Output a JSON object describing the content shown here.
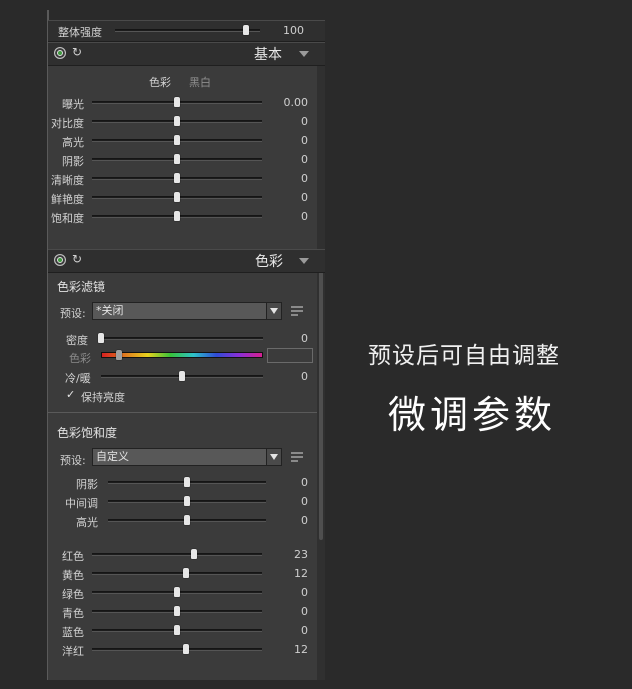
{
  "top": {
    "label": "整体强度",
    "value": "100",
    "level": 0.9
  },
  "basic": {
    "title": "基本",
    "tab_color": "色彩",
    "tab_bw": "黑白",
    "rows": [
      {
        "label": "曝光",
        "value": "0.00",
        "level": 0.5
      },
      {
        "label": "对比度",
        "value": "0",
        "level": 0.5
      },
      {
        "label": "高光",
        "value": "0",
        "level": 0.5
      },
      {
        "label": "阴影",
        "value": "0",
        "level": 0.5
      },
      {
        "label": "清晰度",
        "value": "0",
        "level": 0.5
      },
      {
        "label": "鲜艳度",
        "value": "0",
        "level": 0.5
      },
      {
        "label": "饱和度",
        "value": "0",
        "level": 0.5
      }
    ]
  },
  "color": {
    "title": "色彩",
    "filter": {
      "title": "色彩滤镜",
      "preset_label": "预设:",
      "preset_value": "*关闭",
      "density_label": "密度",
      "density_value": "0",
      "density_level": 0.0,
      "hue_label": "色彩",
      "temp_label": "冷/暖",
      "temp_value": "0",
      "temp_level": 0.5,
      "keep_label": "保持亮度",
      "keep_checked": "✓"
    },
    "saturation": {
      "title": "色彩饱和度",
      "preset_label": "预设:",
      "preset_value": "自定义",
      "tones": [
        {
          "label": "阴影",
          "value": "0",
          "level": 0.5
        },
        {
          "label": "中间调",
          "value": "0",
          "level": 0.5
        },
        {
          "label": "高光",
          "value": "0",
          "level": 0.5
        }
      ],
      "colors": [
        {
          "label": "红色",
          "value": "23",
          "level": 0.6
        },
        {
          "label": "黄色",
          "value": "12",
          "level": 0.55
        },
        {
          "label": "绿色",
          "value": "0",
          "level": 0.5
        },
        {
          "label": "青色",
          "value": "0",
          "level": 0.5
        },
        {
          "label": "蓝色",
          "value": "0",
          "level": 0.5
        },
        {
          "label": "洋红",
          "value": "12",
          "level": 0.55
        }
      ]
    }
  },
  "captions": {
    "line1": "预设后可自由调整",
    "line2": "微调参数"
  },
  "colors": {
    "background": "#2a2a2a",
    "panel": "#3b3b3b",
    "accent_green": "#3f9a3f"
  }
}
